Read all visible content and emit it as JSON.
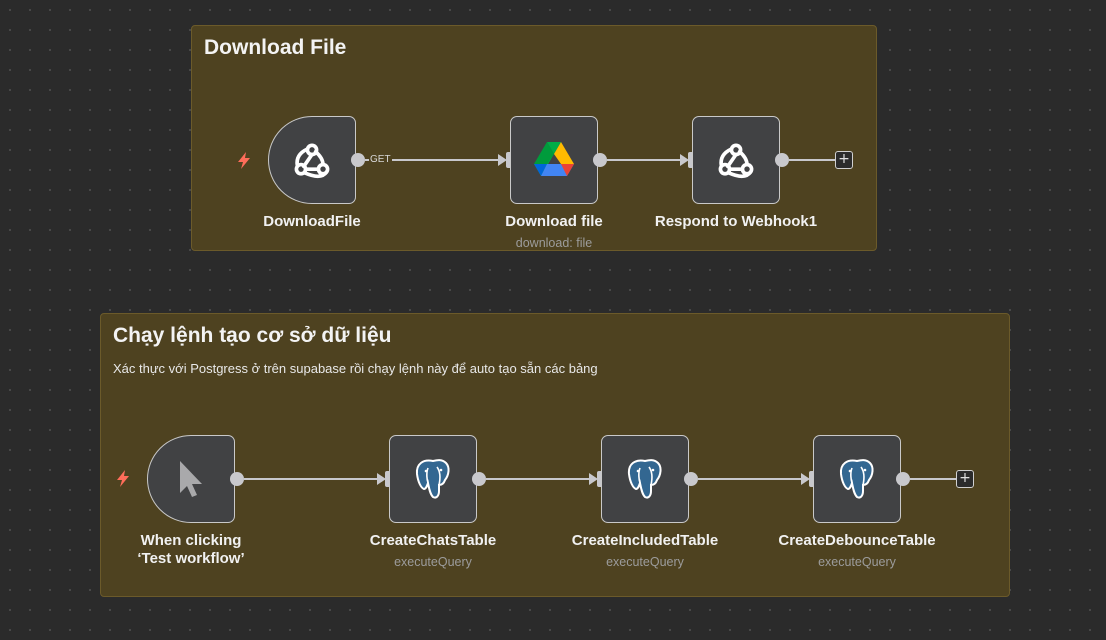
{
  "colors": {
    "canvas_bg": "#2b2b2b",
    "sticky_bg": "#4e4220",
    "node_bg": "#414244",
    "connection": "#c8c8cc",
    "trigger_bolt": "#ff6d5a",
    "postgres_blue": "#336791"
  },
  "sticky_download": {
    "title": "Download File"
  },
  "sticky_db": {
    "title": "Chạy lệnh tạo cơ sở dữ liệu",
    "description": "Xác thực với Postgress ở trên supabase rồi chạy lệnh này để auto tạo sẵn các bảng"
  },
  "workflow_download": {
    "nodes": [
      {
        "label": "DownloadFile",
        "icon": "webhook-icon"
      },
      {
        "label": "Download file",
        "subtitle": "download: file",
        "icon": "google-drive-icon"
      },
      {
        "label": "Respond to Webhook1",
        "icon": "webhook-icon"
      }
    ],
    "connection_label": "GET"
  },
  "workflow_db": {
    "nodes": [
      {
        "label": "When clicking ‘Test workflow’",
        "icon": "cursor-icon"
      },
      {
        "label": "CreateChatsTable",
        "subtitle": "executeQuery",
        "icon": "postgres-icon"
      },
      {
        "label": "CreateIncludedTable",
        "subtitle": "executeQuery",
        "icon": "postgres-icon"
      },
      {
        "label": "CreateDebounceTable",
        "subtitle": "executeQuery",
        "icon": "postgres-icon"
      }
    ]
  },
  "add_node_label": "+"
}
